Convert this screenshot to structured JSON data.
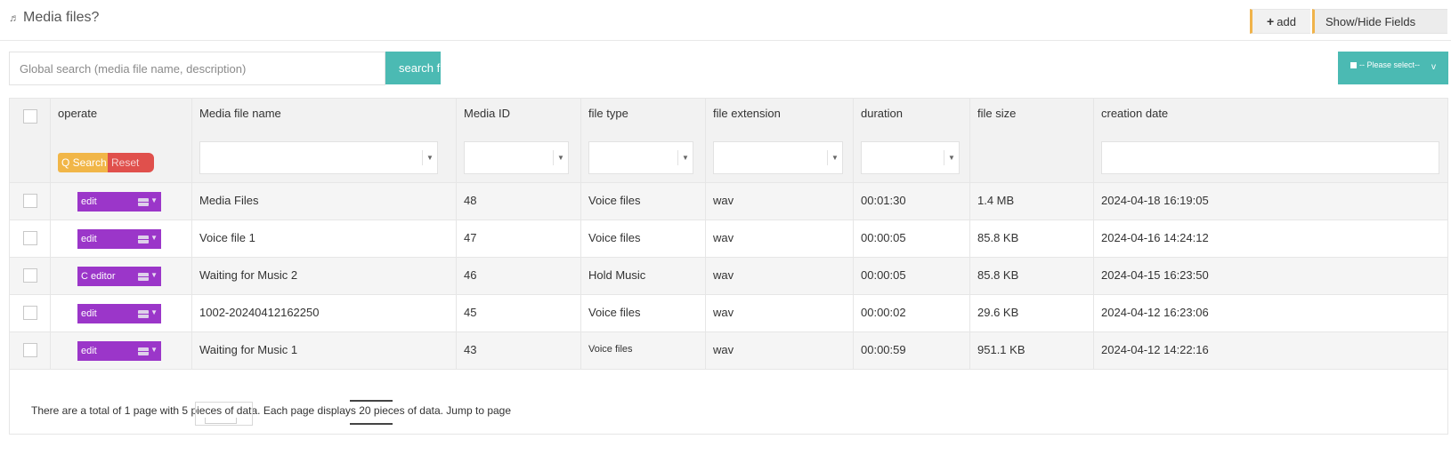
{
  "header": {
    "title": "Media files?",
    "title_icon": "music-note-icon",
    "add_plus": "+",
    "add_label": "add",
    "show_hide_label": "Show/Hide Fields"
  },
  "search": {
    "placeholder": "Global search (media file name, description)",
    "button_label": "search f"
  },
  "select": {
    "label": "-- Please select--",
    "chevron": "v"
  },
  "columns": [
    "operate",
    "Media file name",
    "Media ID",
    "file type",
    "file extension",
    "duration",
    "file size",
    "creation date"
  ],
  "filters": {
    "search_label": "Q Search",
    "reset_label": "Reset",
    "arrow": "▼"
  },
  "rows": [
    {
      "action": "edit",
      "name": "Media Files",
      "media_id": "48",
      "file_type": "Voice files",
      "extension": "wav",
      "duration": "00:01:30",
      "size": "1.4 MB",
      "created": "2024-04-18 16:19:05"
    },
    {
      "action": "edit",
      "name": "Voice file 1",
      "media_id": "47",
      "file_type": "Voice files",
      "extension": "wav",
      "duration": "00:00:05",
      "size": "85.8 KB",
      "created": "2024-04-16 14:24:12"
    },
    {
      "action": "C editor",
      "name": "Waiting for Music 2",
      "media_id": "46",
      "file_type": "Hold Music",
      "extension": "wav",
      "duration": "00:00:05",
      "size": "85.8 KB",
      "created": "2024-04-15 16:23:50"
    },
    {
      "action": "edit",
      "name": "1002-20240412162250",
      "media_id": "45",
      "file_type": "Voice files",
      "extension": "wav",
      "duration": "00:00:02",
      "size": "29.6 KB",
      "created": "2024-04-12 16:23:06"
    },
    {
      "action": "edit",
      "name": "Waiting for Music 1",
      "media_id": "43",
      "file_type": "Voice files",
      "extension": "wav",
      "duration": "00:00:59",
      "size": "951.1 KB",
      "created": "2024-04-12 14:22:16"
    }
  ],
  "footer": {
    "text": "There are a total of 1 page with 5 pieces of data. Each page displays 20 pieces of data. Jump to page"
  },
  "colors": {
    "teal": "#4bbab3",
    "purple": "#9b36c9",
    "orange": "#f1b648",
    "red": "#e0504c"
  }
}
